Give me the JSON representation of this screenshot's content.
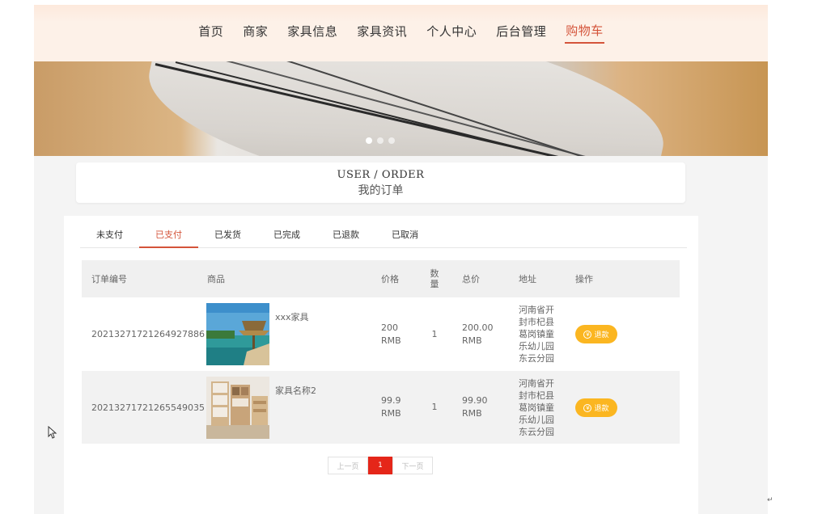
{
  "nav": {
    "items": [
      "首页",
      "商家",
      "家具信息",
      "家具资讯",
      "个人中心",
      "后台管理",
      "购物车"
    ],
    "active_index": 6
  },
  "banner": {
    "slides": 3,
    "active_slide": 0
  },
  "header": {
    "title_en": "USER / ORDER",
    "title_cn": "我的订单"
  },
  "tabs": {
    "items": [
      "未支付",
      "已支付",
      "已发货",
      "已完成",
      "已退款",
      "已取消"
    ],
    "active_index": 1
  },
  "table": {
    "columns": {
      "id": "订单编号",
      "goods": "商品",
      "price": "价格",
      "qty": "数量",
      "total": "总价",
      "address": "地址",
      "action": "操作"
    },
    "rows": [
      {
        "id": "20213271721264927886",
        "goods": "xxx家具",
        "price_value": "200",
        "price_unit": "RMB",
        "qty": "1",
        "total_value": "200.00",
        "total_unit": "RMB",
        "address": "河南省开封市杞县葛岗镇童乐幼儿园东云分园",
        "action": "退款",
        "image": "beach-hut-photo"
      },
      {
        "id": "20213271721265549035",
        "goods": "家具名称2",
        "price_value": "99.9",
        "price_unit": "RMB",
        "qty": "1",
        "total_value": "99.90",
        "total_unit": "RMB",
        "address": "河南省开封市杞县葛岗镇童乐幼儿园东云分园",
        "action": "退款",
        "image": "bookshelf-photo"
      }
    ]
  },
  "pagination": {
    "prev": "上一页",
    "current": "1",
    "next": "下一页"
  },
  "colors": {
    "accent": "#d4543a",
    "refund_button": "#fbb621",
    "page_active": "#e52619"
  }
}
